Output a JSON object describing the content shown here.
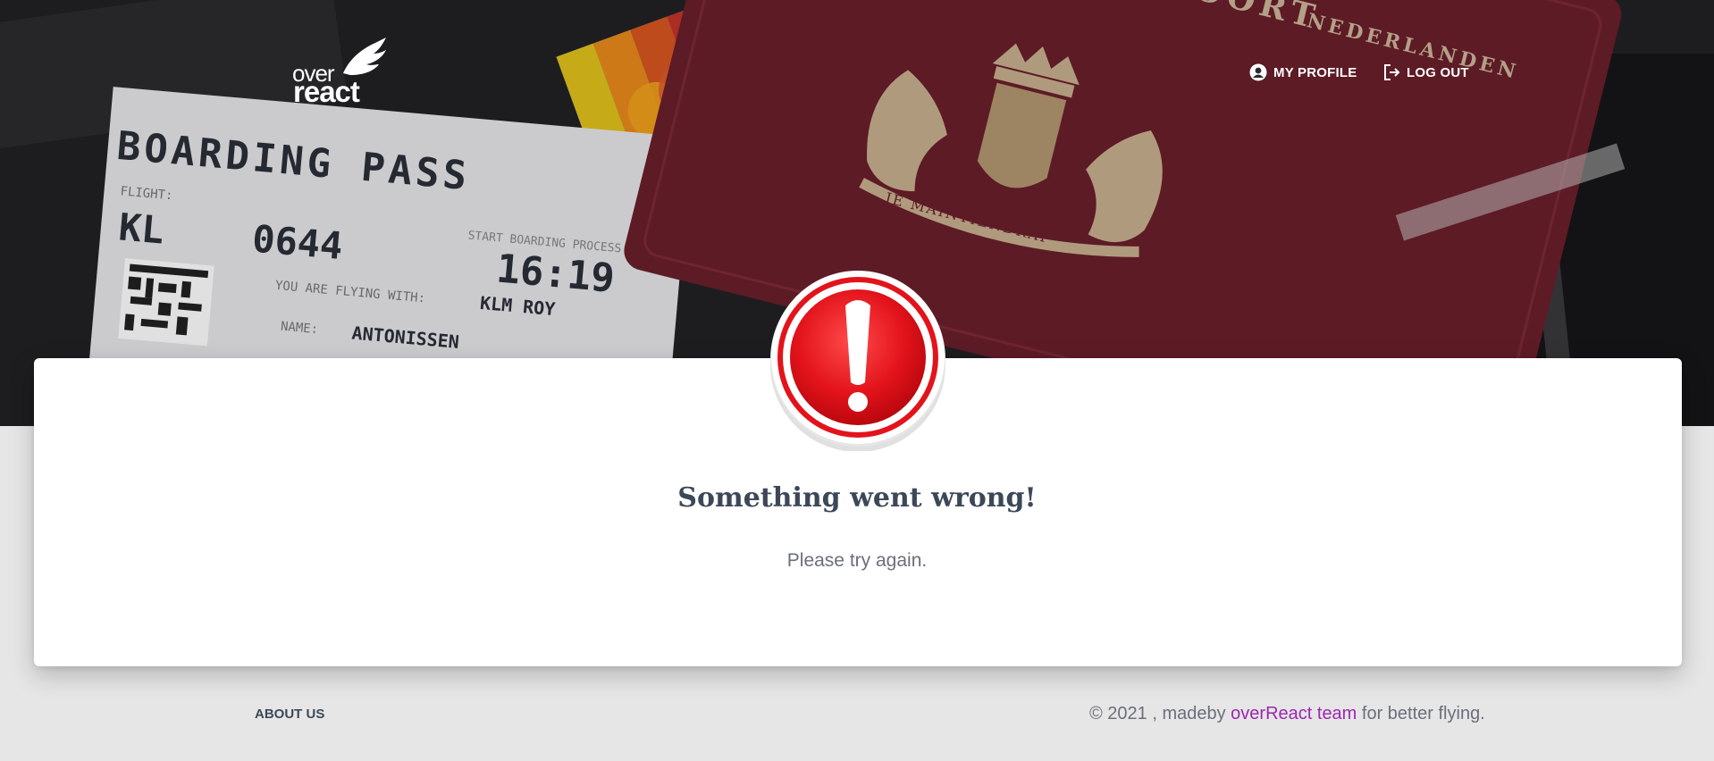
{
  "header": {
    "logo": {
      "line1": "over",
      "line2": "react"
    },
    "nav": {
      "profile_label": "MY PROFILE",
      "profile_icon": "account-circle-icon",
      "logout_label": "LOG OUT",
      "logout_icon": "logout-icon"
    }
  },
  "hero": {
    "boarding_pass": {
      "heading": "BOARDING PASS",
      "flight_label": "FLIGHT:",
      "flight_code": "KL",
      "flight_number": "0644",
      "boarding_label": "START BOARDING PROCESS",
      "boarding_time": "16:19",
      "flying_with_label": "YOU ARE FLYING WITH:",
      "airline": "KLM ROY",
      "name_label": "NAME:",
      "name": "ANTONISSEN"
    },
    "passport": {
      "top_text": "PASPOORT",
      "country": "NEDERLANDEN",
      "motto": "JE MAINTIENDRAI"
    }
  },
  "error": {
    "icon": "exclamation-alert-icon",
    "title": "Something went wrong!",
    "message": "Please try again."
  },
  "footer": {
    "about_label": "ABOUT US",
    "copy_prefix": "© 2021 , madeby ",
    "team_link": "overReact team",
    "copy_suffix": " for better flying."
  },
  "colors": {
    "accent": "#9c27b0",
    "alert_red": "#e3131b",
    "heading": "#3c4858",
    "page_background": "#e6e6e6"
  }
}
